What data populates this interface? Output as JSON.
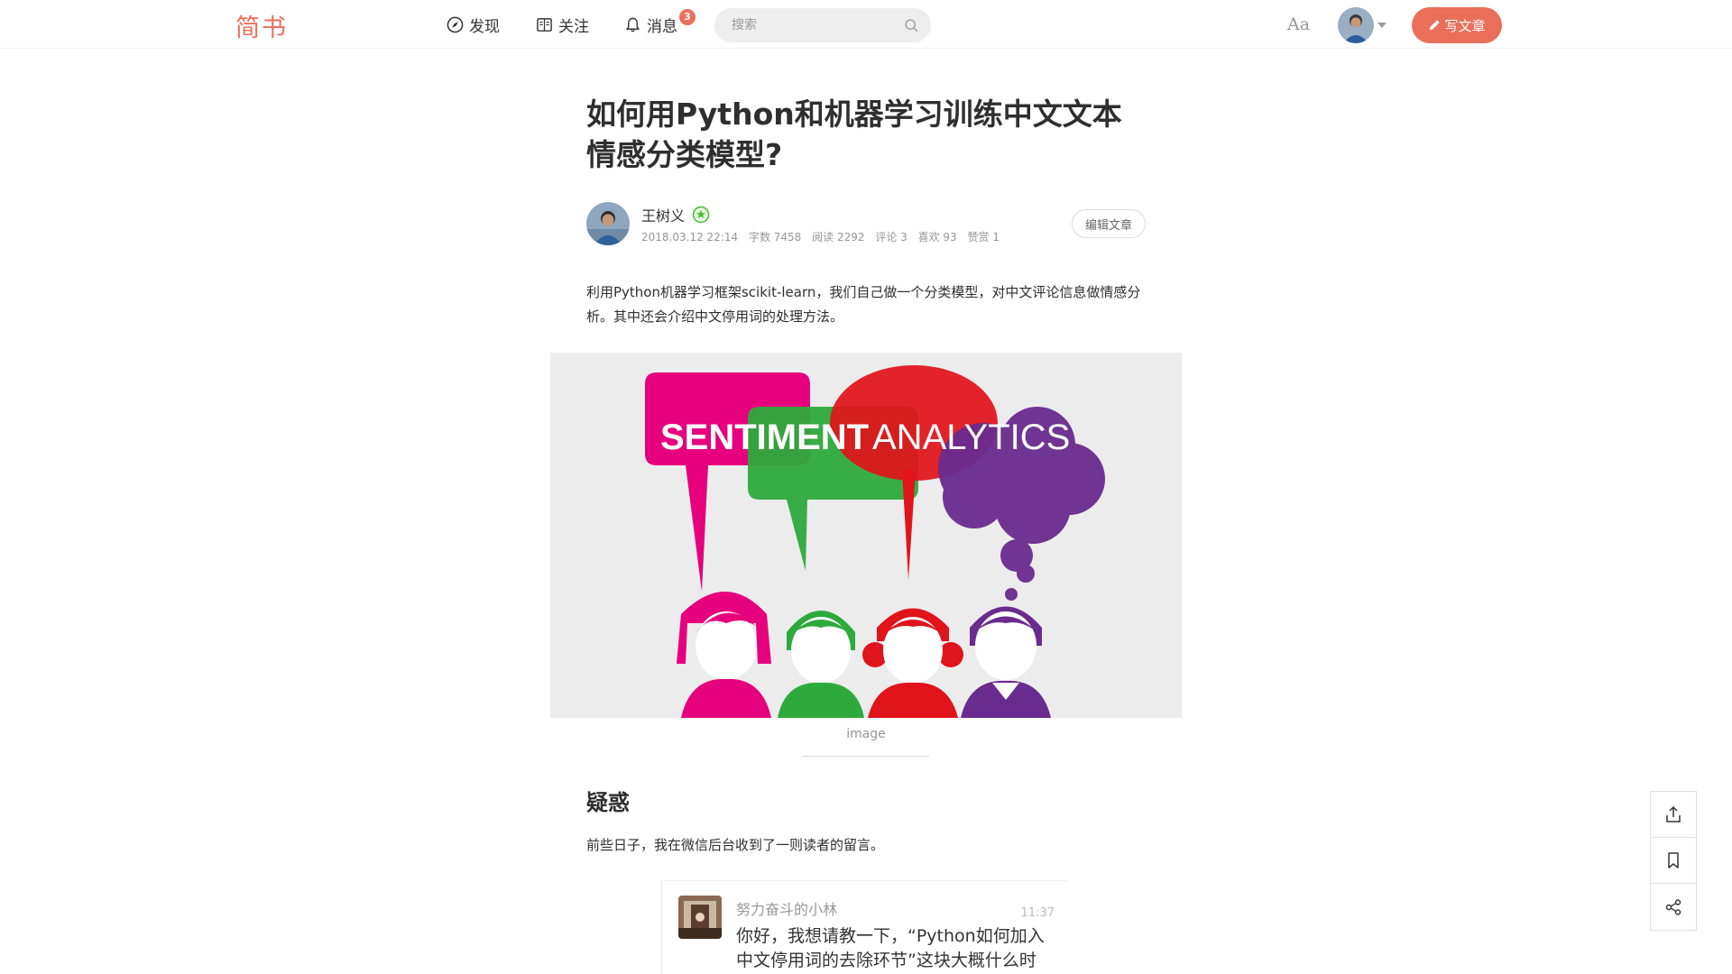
{
  "header": {
    "logo": "简书",
    "nav": [
      {
        "label": "发现",
        "icon": "compass-icon"
      },
      {
        "label": "关注",
        "icon": "book-icon"
      },
      {
        "label": "消息",
        "icon": "bell-icon"
      }
    ],
    "notification_count": "3",
    "search_placeholder": "搜索",
    "font_toggle": "Aa",
    "write_label": "写文章",
    "accent_color": "#ea6f5a"
  },
  "article": {
    "title": "如何用Python和机器学习训练中文文本情感分类模型?",
    "author": {
      "name": "王树义",
      "date": "2018.03.12 22:14",
      "word_count": "字数 7458",
      "reads": "阅读 2292",
      "comments": "评论 3",
      "likes": "喜欢 93",
      "rewards": "赞赏 1"
    },
    "edit_label": "编辑文章",
    "intro": "利用Python机器学习框架scikit-learn，我们自己做一个分类模型，对中文评论信息做情感分析。其中还会介绍中文停用词的处理方法。",
    "image": {
      "caption": "image",
      "headline_bold": "SENTIMENT",
      "headline_light": "ANALYTICS"
    },
    "section_heading": "疑惑",
    "section_para": "前些日子，我在微信后台收到了一则读者的留言。",
    "chat": {
      "name": "努力奋斗的小林",
      "time": "11:37",
      "message": "你好，我想请教一下，“Python如何加入中文停用词的去除环节”这块大概什么时"
    }
  },
  "tools": [
    {
      "icon": "share-upload-icon"
    },
    {
      "icon": "bookmark-icon"
    },
    {
      "icon": "share-nodes-icon"
    }
  ]
}
